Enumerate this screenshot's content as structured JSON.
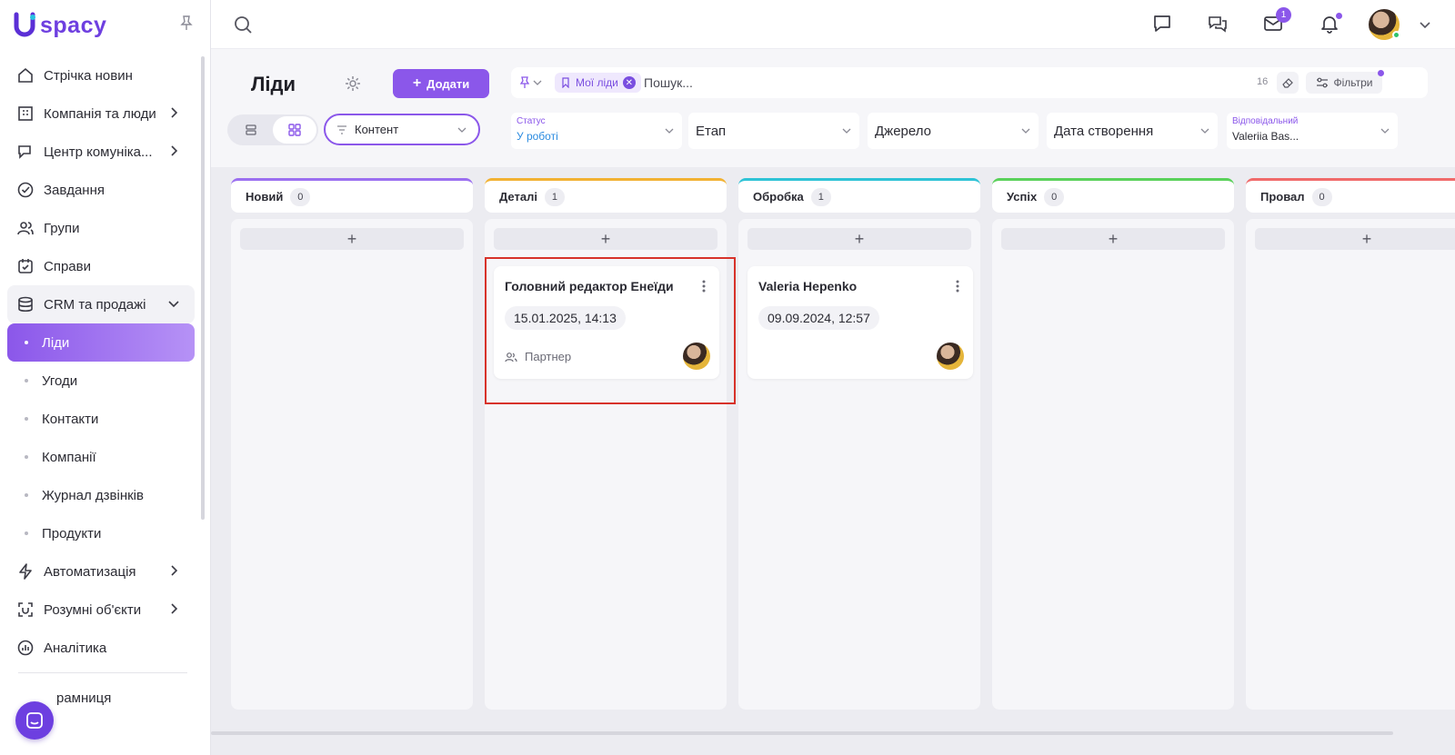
{
  "app": {
    "logo_text": "spacy"
  },
  "sidebar": {
    "items": [
      {
        "label": "Стрічка новин",
        "icon": "home-icon"
      },
      {
        "label": "Компанія та люди",
        "icon": "building-icon",
        "has_arrow": true
      },
      {
        "label": "Центр комуніка...",
        "icon": "chat-edit-icon",
        "has_arrow": true
      },
      {
        "label": "Завдання",
        "icon": "check-circle-icon"
      },
      {
        "label": "Групи",
        "icon": "users-icon"
      },
      {
        "label": "Справи",
        "icon": "calendar-check-icon"
      }
    ],
    "crm": {
      "label": "CRM та продажі",
      "icon": "database-icon"
    },
    "crm_sub": [
      "Ліди",
      "Угоди",
      "Контакти",
      "Компанії",
      "Журнал дзвінків",
      "Продукти"
    ],
    "items_after": [
      {
        "label": "Автоматизація",
        "icon": "lightning-icon",
        "has_arrow": true
      },
      {
        "label": "Розумні об'єкти",
        "icon": "scan-icon",
        "has_arrow": true
      },
      {
        "label": "Аналітика",
        "icon": "chart-circle-icon"
      }
    ],
    "bottom_item": "рамниця"
  },
  "topbar": {
    "mail_badge": "1"
  },
  "page": {
    "title": "Ліди",
    "add_button": "Додати",
    "content_select": "Контент"
  },
  "search": {
    "chip": "Мої ліди",
    "placeholder": "Пошук...",
    "count": "16",
    "filters_label": "Фільтри"
  },
  "filters": {
    "status_label": "Статус",
    "status_value": "У роботі",
    "stage": "Етап",
    "source": "Джерело",
    "created": "Дата створення",
    "responsible_label": "Відповідальний",
    "responsible_value": "Valeriia Bas..."
  },
  "columns": [
    {
      "name": "Новий",
      "count": "0",
      "color": "#9b6ff0"
    },
    {
      "name": "Деталі",
      "count": "1",
      "color": "#f2b233"
    },
    {
      "name": "Обробка",
      "count": "1",
      "color": "#2ec3d6"
    },
    {
      "name": "Успіх",
      "count": "0",
      "color": "#5ad15a"
    },
    {
      "name": "Провал",
      "count": "0",
      "color": "#f06a6a"
    }
  ],
  "cards": [
    {
      "title": "Головний редактор Енеїди",
      "date": "15.01.2025, 14:13",
      "partner": "Партнер"
    },
    {
      "title": "Valeria Hepenko",
      "date": "09.09.2024, 12:57"
    }
  ]
}
